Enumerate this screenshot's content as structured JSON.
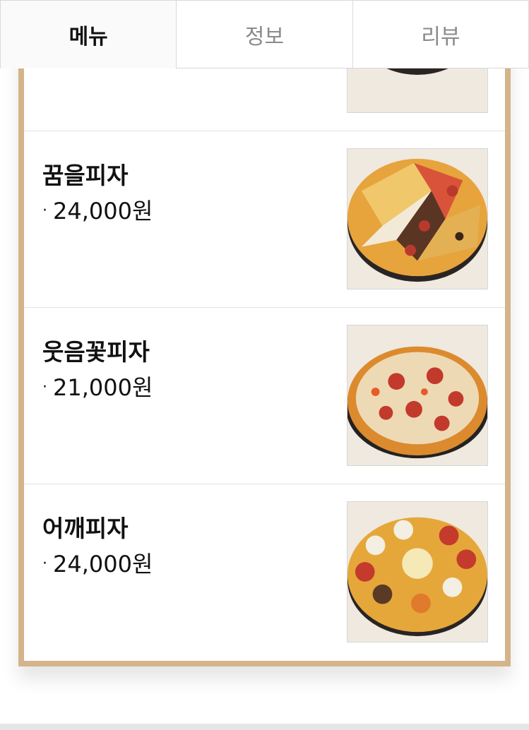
{
  "tabs": [
    {
      "label": "메뉴",
      "active": true
    },
    {
      "label": "정보",
      "active": false
    },
    {
      "label": "리뷰",
      "active": false
    }
  ],
  "menu": {
    "items": [
      {
        "name": "꿈을피자",
        "price": "24,000원",
        "image": "combination-pizza-photo"
      },
      {
        "name": "웃음꽃피자",
        "price": "21,000원",
        "image": "pepperoni-pizza-photo"
      },
      {
        "name": "어깨피자",
        "price": "24,000원",
        "image": "cheese-topping-pizza-photo"
      }
    ],
    "bullet": "·"
  },
  "colors": {
    "panel_border": "#d4b48a",
    "active_tab_text": "#111111",
    "inactive_tab_text": "#8a8a8a"
  }
}
